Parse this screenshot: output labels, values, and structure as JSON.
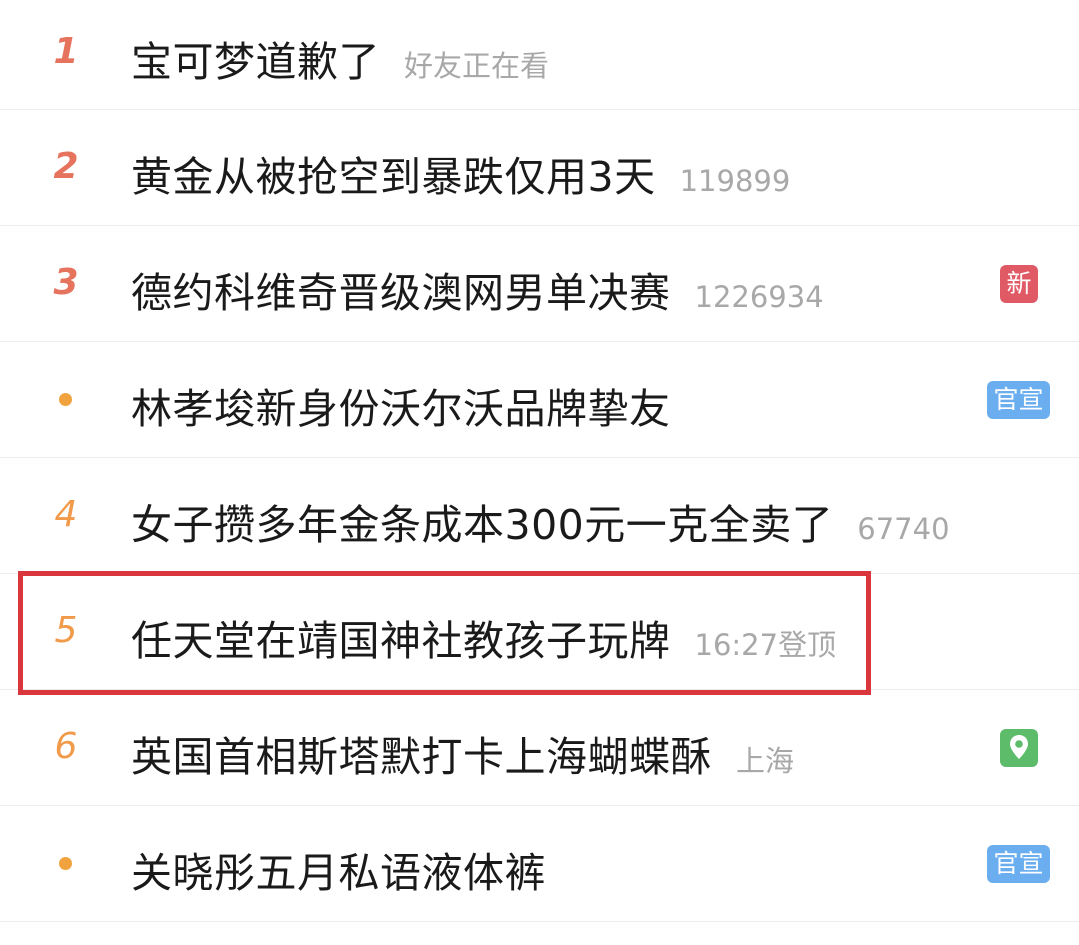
{
  "hot_list": [
    {
      "rank": "1",
      "title": "宝可梦道歉了",
      "meta": "好友正在看",
      "badge": null
    },
    {
      "rank": "2",
      "title": "黄金从被抢空到暴跌仅用3天",
      "meta": "119899",
      "badge": null
    },
    {
      "rank": "3",
      "title": "德约科维奇晋级澳网男单决赛",
      "meta": "1226934",
      "badge": "新"
    },
    {
      "rank": null,
      "title": "林孝埈新身份沃尔沃品牌挚友",
      "meta": null,
      "badge": "官宣"
    },
    {
      "rank": "4",
      "title": "女子攒多年金条成本300元一克全卖了",
      "meta": "67740",
      "badge": null
    },
    {
      "rank": "5",
      "title": "任天堂在靖国神社教孩子玩牌",
      "meta": "16:27登顶",
      "badge": null
    },
    {
      "rank": "6",
      "title": "英国首相斯塔默打卡上海蝴蝶酥",
      "meta": "上海",
      "badge": "location-pin-icon"
    },
    {
      "rank": null,
      "title": "关晓彤五月私语液体裤",
      "meta": null,
      "badge": "官宣"
    }
  ],
  "highlighted_item_index": 5,
  "colors": {
    "rank_top": "#e5735d",
    "rank_normal": "#f09a4a",
    "promo_dot": "#f0a23f",
    "badge_new": "#e05a66",
    "badge_official": "#6aaef0",
    "badge_location": "#5cbc6a",
    "highlight_box": "#d9363e"
  }
}
